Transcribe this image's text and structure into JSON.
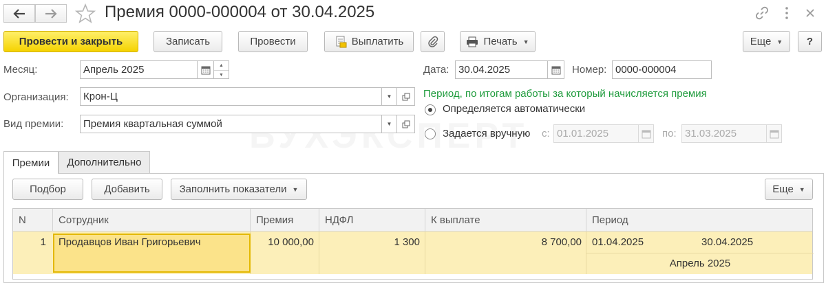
{
  "window": {
    "title": "Премия 0000-000004 от 30.04.2025"
  },
  "toolbar": {
    "post_close": "Провести и закрыть",
    "save": "Записать",
    "post": "Провести",
    "pay": "Выплатить",
    "print": "Печать",
    "more": "Еще",
    "help": "?"
  },
  "form": {
    "month_label": "Месяц:",
    "month_value": "Апрель 2025",
    "org_label": "Организация:",
    "org_value": "Крон-Ц",
    "bonus_type_label": "Вид премии:",
    "bonus_type_value": "Премия квартальная суммой",
    "date_label": "Дата:",
    "date_value": "30.04.2025",
    "number_label": "Номер:",
    "number_value": "0000-000004",
    "period_caption": "Период, по итогам работы за который начисляется премия",
    "radio_auto": "Определяется автоматически",
    "radio_manual": "Задается вручную",
    "from_label": "с:",
    "from_value": "01.01.2025",
    "to_label": "по:",
    "to_value": "31.03.2025"
  },
  "watermark": "БУХЭКСПЕРТ",
  "tabs": [
    {
      "label": "Премии"
    },
    {
      "label": "Дополнительно"
    }
  ],
  "table_toolbar": {
    "pick": "Подбор",
    "add": "Добавить",
    "fill": "Заполнить показатели",
    "more": "Еще"
  },
  "table": {
    "columns": [
      "N",
      "Сотрудник",
      "Премия",
      "НДФЛ",
      "К выплате",
      "Период"
    ],
    "rows": [
      {
        "n": "1",
        "employee": "Продавцов Иван Григорьевич",
        "bonus": "10 000,00",
        "ndfl": "1 300",
        "payout": "8 700,00",
        "period_from": "01.04.2025",
        "period_to": "30.04.2025",
        "period_month": "Апрель 2025"
      }
    ]
  },
  "colors": {
    "primary_button": "#f5d300",
    "selected_row": "#fcefb9",
    "selected_cell_border": "#e3b800",
    "period_caption": "#1e9b3c"
  }
}
